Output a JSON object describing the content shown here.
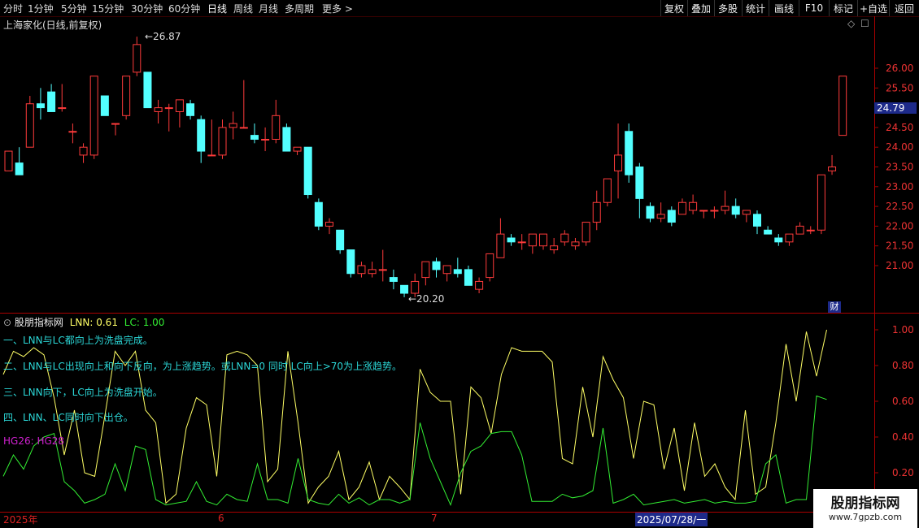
{
  "toolbar": {
    "periods": [
      "分时",
      "1分钟",
      "5分钟",
      "15分钟",
      "30分钟",
      "60分钟",
      "日线",
      "周线",
      "月线",
      "多周期",
      "更多 >"
    ],
    "active": "日线",
    "right": [
      "复权",
      "叠加",
      "多股",
      "统计",
      "画线",
      "F10",
      "标记",
      "+自选",
      "返回"
    ]
  },
  "chart_title": "上海家化(日线,前复权)",
  "price_axis": [
    "26.00",
    "25.50",
    "25.00",
    "24.50",
    "24.00",
    "23.50",
    "23.00",
    "22.50",
    "22.00",
    "21.50",
    "21.00"
  ],
  "current_price": "24.79",
  "high_label": "26.87",
  "low_label": "20.20",
  "cai_label": "财",
  "indicator": {
    "name": "股朋指标网",
    "lnn_label": "LNN: 0.61",
    "lc_label": "LC: 1.00",
    "notes": [
      "一、LNN与LC都向上为洗盘完成。",
      "二、LNN与LC出现向上和向下反向，为上涨趋势。或LNN=0 同时 LC向上>70为上涨趋势。",
      "三、LNN向下，LC向上为洗盘开始。",
      "四、LNN、LC同时向下出仓。"
    ],
    "hg": "HG26: HG28",
    "axis": [
      "1.00",
      "0.80",
      "0.60",
      "0.40",
      "0.20"
    ]
  },
  "dates": {
    "start": "2025年",
    "m6": "6",
    "m7": "7",
    "selected": "2025/07/28/一"
  },
  "watermark": {
    "title": "股朋指标网",
    "url": "www.7gpzb.com"
  },
  "colors": {
    "up": "#ff3b3b",
    "down": "#53ffff",
    "lnn": "#ffff66",
    "lc": "#33ee33",
    "axis": "#aa0000"
  },
  "chart_data": {
    "type": "candlestick",
    "candles": [
      [
        23.4,
        23.9,
        23.4,
        23.9
      ],
      [
        23.6,
        24.0,
        23.3,
        23.3
      ],
      [
        24.0,
        25.3,
        24.0,
        25.1
      ],
      [
        25.1,
        25.5,
        24.7,
        25.0
      ],
      [
        25.4,
        25.6,
        24.9,
        24.9
      ],
      [
        25.0,
        25.6,
        24.9,
        25.0
      ],
      [
        24.4,
        24.6,
        24.1,
        24.4
      ],
      [
        23.8,
        24.1,
        23.6,
        24.0
      ],
      [
        23.8,
        25.8,
        23.7,
        25.8
      ],
      [
        25.3,
        25.3,
        24.8,
        24.8
      ],
      [
        24.6,
        24.6,
        24.3,
        24.6
      ],
      [
        24.8,
        25.8,
        24.7,
        25.8
      ],
      [
        25.9,
        26.8,
        25.8,
        26.6
      ],
      [
        25.9,
        25.9,
        25.0,
        25.0
      ],
      [
        24.9,
        25.2,
        24.6,
        25.0
      ],
      [
        25.0,
        25.1,
        24.4,
        25.0
      ],
      [
        24.9,
        25.2,
        24.5,
        25.2
      ],
      [
        25.1,
        25.2,
        24.7,
        24.8
      ],
      [
        24.7,
        24.8,
        23.6,
        23.9
      ],
      [
        23.8,
        24.7,
        23.8,
        23.8
      ],
      [
        23.8,
        24.7,
        23.7,
        24.5
      ],
      [
        24.5,
        24.9,
        24.2,
        24.6
      ],
      [
        24.5,
        25.7,
        24.5,
        24.5
      ],
      [
        24.3,
        24.6,
        24.1,
        24.2
      ],
      [
        24.2,
        24.5,
        23.9,
        24.2
      ],
      [
        24.2,
        25.2,
        24.1,
        24.8
      ],
      [
        24.5,
        24.6,
        23.9,
        23.9
      ],
      [
        23.9,
        24.0,
        23.8,
        24.0
      ],
      [
        24.0,
        24.0,
        22.7,
        22.8
      ],
      [
        22.6,
        22.7,
        21.9,
        22.0
      ],
      [
        22.0,
        22.2,
        21.8,
        22.1
      ],
      [
        21.9,
        21.9,
        21.3,
        21.4
      ],
      [
        21.4,
        21.4,
        20.7,
        20.8
      ],
      [
        20.8,
        21.1,
        20.7,
        21.0
      ],
      [
        20.8,
        21.1,
        20.7,
        20.9
      ],
      [
        20.9,
        21.4,
        20.6,
        20.9
      ],
      [
        20.7,
        20.9,
        20.4,
        20.6
      ],
      [
        20.5,
        20.5,
        20.2,
        20.3
      ],
      [
        20.3,
        20.8,
        20.2,
        20.6
      ],
      [
        20.7,
        21.1,
        20.5,
        21.1
      ],
      [
        21.1,
        21.2,
        20.7,
        20.9
      ],
      [
        20.8,
        21.0,
        20.6,
        21.0
      ],
      [
        20.9,
        21.2,
        20.7,
        20.8
      ],
      [
        20.9,
        21.0,
        20.5,
        20.5
      ],
      [
        20.4,
        20.7,
        20.3,
        20.6
      ],
      [
        20.7,
        21.3,
        20.6,
        21.3
      ],
      [
        21.2,
        22.2,
        21.2,
        21.8
      ],
      [
        21.7,
        21.8,
        21.5,
        21.6
      ],
      [
        21.6,
        21.8,
        21.4,
        21.6
      ],
      [
        21.5,
        21.8,
        21.3,
        21.8
      ],
      [
        21.5,
        21.8,
        21.4,
        21.8
      ],
      [
        21.4,
        21.7,
        21.3,
        21.5
      ],
      [
        21.6,
        21.9,
        21.5,
        21.8
      ],
      [
        21.5,
        21.7,
        21.4,
        21.6
      ],
      [
        21.6,
        22.1,
        21.5,
        22.1
      ],
      [
        22.1,
        22.9,
        21.9,
        22.6
      ],
      [
        22.6,
        23.2,
        22.5,
        23.2
      ],
      [
        23.4,
        24.6,
        22.7,
        23.8
      ],
      [
        24.4,
        24.6,
        23.1,
        23.3
      ],
      [
        23.5,
        23.6,
        22.2,
        22.7
      ],
      [
        22.5,
        22.6,
        22.1,
        22.2
      ],
      [
        22.2,
        22.6,
        22.1,
        22.3
      ],
      [
        22.4,
        22.5,
        22.0,
        22.1
      ],
      [
        22.3,
        22.7,
        22.3,
        22.6
      ],
      [
        22.4,
        22.8,
        22.3,
        22.6
      ],
      [
        22.4,
        22.4,
        22.2,
        22.4
      ],
      [
        22.4,
        22.5,
        22.2,
        22.4
      ],
      [
        22.4,
        22.9,
        22.3,
        22.5
      ],
      [
        22.5,
        22.7,
        22.2,
        22.3
      ],
      [
        22.3,
        22.4,
        22.1,
        22.4
      ],
      [
        22.3,
        22.4,
        21.8,
        22.0
      ],
      [
        21.9,
        22.0,
        21.8,
        21.8
      ],
      [
        21.7,
        21.8,
        21.5,
        21.6
      ],
      [
        21.6,
        21.8,
        21.5,
        21.8
      ],
      [
        21.8,
        22.1,
        21.8,
        22.0
      ],
      [
        21.9,
        22.0,
        21.8,
        21.9
      ],
      [
        21.9,
        23.3,
        21.8,
        23.3
      ],
      [
        23.4,
        23.8,
        23.3,
        23.5
      ],
      [
        24.3,
        25.8,
        24.3,
        25.8
      ]
    ],
    "lnn": [
      0.75,
      0.88,
      0.85,
      0.9,
      0.86,
      0.62,
      0.3,
      0.55,
      0.2,
      0.18,
      0.52,
      0.88,
      0.8,
      0.88,
      0.55,
      0.48,
      0.03,
      0.08,
      0.45,
      0.62,
      0.58,
      0.18,
      0.86,
      0.88,
      0.86,
      0.8,
      0.15,
      0.22,
      0.88,
      0.48,
      0.03,
      0.12,
      0.18,
      0.32,
      0.05,
      0.12,
      0.26,
      0.05,
      0.18,
      0.12,
      0.05,
      0.78,
      0.65,
      0.6,
      0.6,
      0.08,
      0.68,
      0.62,
      0.42,
      0.75,
      0.9,
      0.88,
      0.88,
      0.88,
      0.82,
      0.28,
      0.25,
      0.68,
      0.4,
      0.85,
      0.72,
      0.62,
      0.28,
      0.6,
      0.58,
      0.22,
      0.45,
      0.1,
      0.48,
      0.18,
      0.25,
      0.12,
      0.05,
      0.55,
      0.08,
      0.12,
      0.48,
      0.92,
      0.6,
      0.99,
      0.74,
      1.0
    ],
    "lc": [
      0.18,
      0.3,
      0.22,
      0.35,
      0.4,
      0.42,
      0.15,
      0.1,
      0.03,
      0.05,
      0.08,
      0.25,
      0.1,
      0.35,
      0.33,
      0.05,
      0.02,
      0.03,
      0.04,
      0.15,
      0.04,
      0.02,
      0.08,
      0.05,
      0.04,
      0.25,
      0.05,
      0.05,
      0.03,
      0.28,
      0.05,
      0.03,
      0.02,
      0.08,
      0.03,
      0.06,
      0.02,
      0.05,
      0.05,
      0.03,
      0.05,
      0.48,
      0.28,
      0.15,
      0.02,
      0.2,
      0.32,
      0.35,
      0.42,
      0.43,
      0.43,
      0.3,
      0.04,
      0.04,
      0.04,
      0.08,
      0.06,
      0.07,
      0.1,
      0.45,
      0.03,
      0.05,
      0.08,
      0.02,
      0.03,
      0.04,
      0.05,
      0.03,
      0.04,
      0.05,
      0.03,
      0.04,
      0.03,
      0.03,
      0.04,
      0.25,
      0.3,
      0.03,
      0.05,
      0.05,
      0.63,
      0.61
    ]
  }
}
